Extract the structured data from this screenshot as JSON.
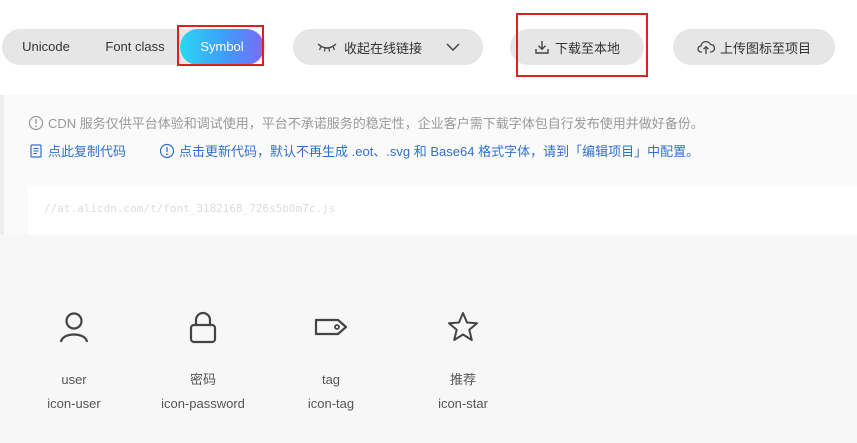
{
  "toolbar": {
    "tabs": [
      "Unicode",
      "Font class",
      "Symbol"
    ],
    "active_tab": "Symbol",
    "collapse_label": "收起在线链接",
    "download_label": "下载至本地",
    "upload_label": "上传图标至项目"
  },
  "notice": {
    "warning": "CDN 服务仅供平台体验和调试使用，平台不承诺服务的稳定性，企业客户需下载字体包自行发布使用并做好备份。",
    "copy_code": "点此复制代码",
    "update_code": "点击更新代码，默认不再生成 .eot、.svg 和 Base64 格式字体，请到「编辑项目」中配置。"
  },
  "code_url": "//at.alicdn.com/t/font_3182168_726s5b0m7c.js",
  "icons": [
    {
      "name": "user",
      "code": "icon-user",
      "icon": "user-icon"
    },
    {
      "name": "密码",
      "code": "icon-password",
      "icon": "lock-icon"
    },
    {
      "name": "tag",
      "code": "icon-tag",
      "icon": "tag-icon"
    },
    {
      "name": "推荐",
      "code": "icon-star",
      "icon": "star-icon"
    }
  ],
  "colors": {
    "accent_gradient": [
      "#2ad7f5",
      "#3f9bfb",
      "#7b6cf6"
    ],
    "link_blue": "#3070d0",
    "highlight_red": "#e02020",
    "pill_bg": "#e6e6e6"
  }
}
